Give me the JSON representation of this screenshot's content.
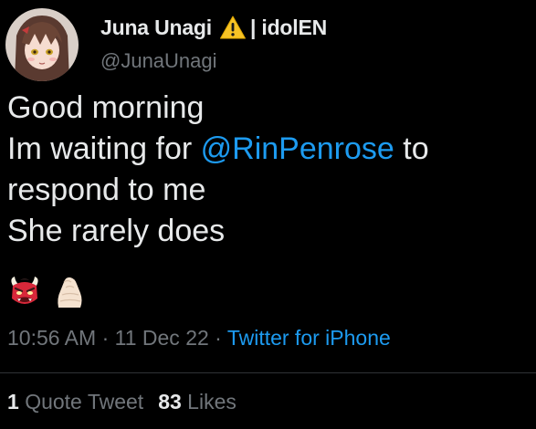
{
  "author": {
    "display_name": "Juna Unagi",
    "name_suffix": "| idolEN",
    "handle": "@JunaUnagi",
    "badge_icon": "warning-icon"
  },
  "tweet": {
    "lines": [
      {
        "before": "Good morning"
      },
      {
        "before": "Im waiting for ",
        "mention": "@RinPenrose",
        "after": " to"
      },
      {
        "before": "respond to me"
      },
      {
        "before": "She rarely does"
      }
    ],
    "emojis": [
      "ogre-icon",
      "pinched-fingers-icon"
    ]
  },
  "meta": {
    "time": "10:56 AM",
    "sep1": " · ",
    "date": "11 Dec 22",
    "sep2": " · ",
    "source": "Twitter for iPhone"
  },
  "stats": {
    "quote_count": "1",
    "quote_label": "Quote Tweet",
    "likes_count": "83",
    "likes_label": "Likes"
  },
  "colors": {
    "background": "#000000",
    "text": "#e7e9ea",
    "secondary": "#71767b",
    "link": "#1d9bf0",
    "divider": "#2f3336"
  }
}
